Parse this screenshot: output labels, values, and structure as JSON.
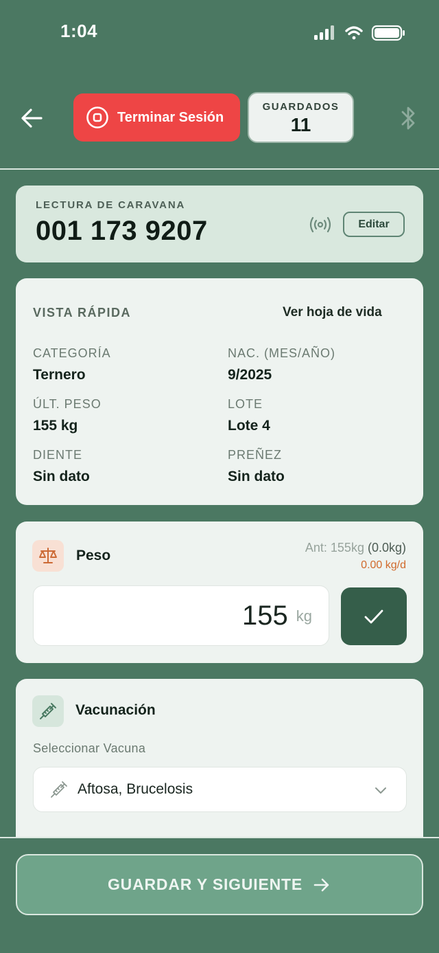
{
  "status_bar": {
    "time": "1:04"
  },
  "header": {
    "end_session_label": "Terminar Sesión",
    "saved_label": "GUARDADOS",
    "saved_count": "11"
  },
  "tag": {
    "label": "LECTURA DE CARAVANA",
    "number": "001 173 9207",
    "edit_label": "Editar"
  },
  "quick_view": {
    "title": "VISTA RÁPIDA",
    "link": "Ver hoja de vida",
    "fields": [
      {
        "label": "CATEGORÍA",
        "value": "Ternero"
      },
      {
        "label": "NAC. (MES/AÑO)",
        "value": "9/2025"
      },
      {
        "label": "ÚLT. PESO",
        "value": "155 kg"
      },
      {
        "label": "LOTE",
        "value": "Lote 4"
      },
      {
        "label": "DIENTE",
        "value": "Sin dato"
      },
      {
        "label": "PREÑEZ",
        "value": "Sin dato"
      }
    ]
  },
  "weight": {
    "title": "Peso",
    "previous_prefix": "Ant: 155kg",
    "previous_diff": "(0.0kg)",
    "rate": "0.00 kg/d",
    "value": "155",
    "unit": "kg"
  },
  "vaccination": {
    "title": "Vacunación",
    "select_label": "Seleccionar Vacuna",
    "selected": "Aftosa, Brucelosis"
  },
  "footer": {
    "save_next_label": "GUARDAR Y SIGUIENTE"
  },
  "colors": {
    "background": "#4b7862",
    "danger": "#ee4545",
    "primary_dark": "#355e4a",
    "accent_orange": "#d16a2c"
  }
}
